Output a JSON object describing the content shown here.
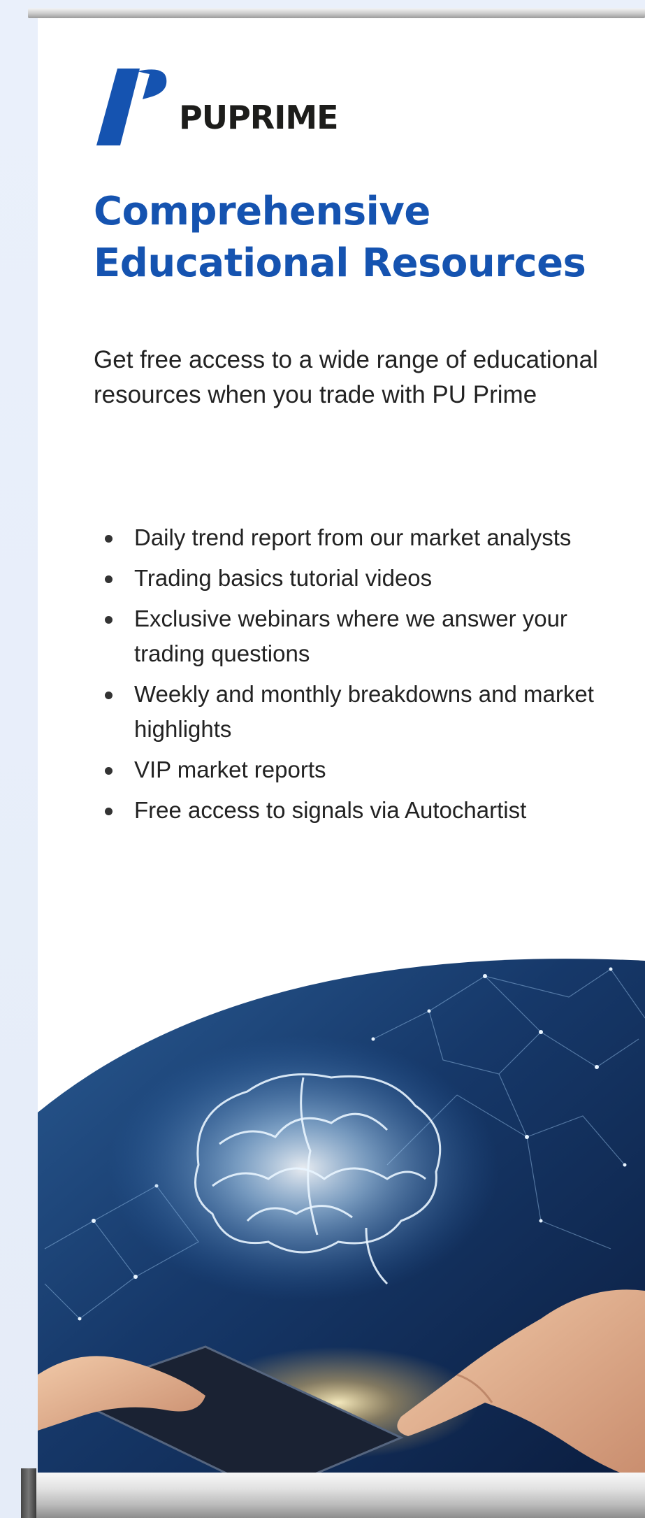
{
  "brand": {
    "name": "PUPRIME",
    "logo_icon": "puprime-p-mark-icon",
    "color": "#1553b0"
  },
  "headline": {
    "line1": "Comprehensive",
    "line2": "Educational Resources"
  },
  "intro": "Get free access to a wide range of educational resources when you trade with PU Prime",
  "features": [
    "Daily trend report from our market analysts",
    "Trading basics tutorial videos",
    "Exclusive webinars where we answer your trading questions",
    "Weekly and monthly breakdowns and market highlights",
    "VIP market reports",
    "Free access to signals via Autochartist"
  ],
  "hero": {
    "image": "glowing-brain-network-illustration",
    "colors": {
      "deep": "#0b1d3f",
      "mid": "#163869",
      "glow": "#bfe3ff"
    }
  }
}
